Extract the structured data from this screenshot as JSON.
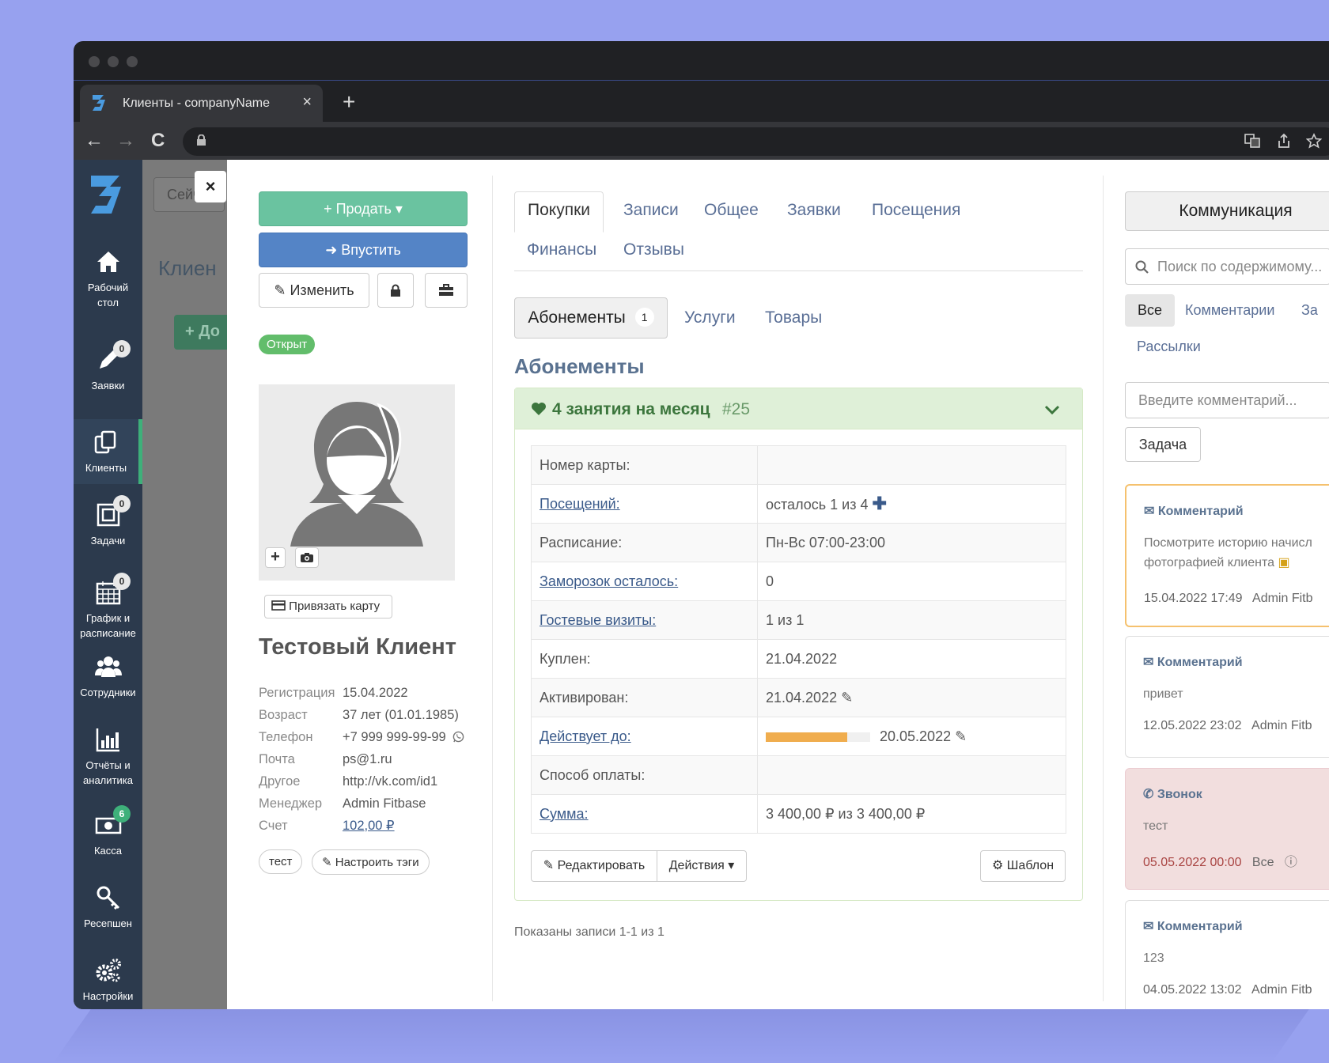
{
  "browser": {
    "tab_title": "Клиенты - companyName",
    "new_tab": "+",
    "tab_close": "×",
    "back": "←",
    "forward": "→",
    "reload": "C"
  },
  "sidebar": {
    "items": [
      {
        "label_line1": "Рабочий",
        "label_line2": "стол",
        "icon": "home-icon"
      },
      {
        "label_line1": "Заявки",
        "label_line2": "",
        "icon": "pencil-icon",
        "badge": "0"
      },
      {
        "label_line1": "Клиенты",
        "label_line2": "",
        "icon": "clients-icon"
      },
      {
        "label_line1": "Задачи",
        "label_line2": "",
        "icon": "tasks-icon",
        "badge": "0"
      },
      {
        "label_line1": "График и",
        "label_line2": "расписание",
        "icon": "calendar-icon",
        "badge": "0"
      },
      {
        "label_line1": "Сотрудники",
        "label_line2": "",
        "icon": "users-icon"
      },
      {
        "label_line1": "Отчёты и",
        "label_line2": "аналитика",
        "icon": "chart-icon"
      },
      {
        "label_line1": "Касса",
        "label_line2": "",
        "icon": "cash-icon",
        "badge": "6"
      },
      {
        "label_line1": "Ресепшен",
        "label_line2": "",
        "icon": "key-icon"
      },
      {
        "label_line1": "Настройки",
        "label_line2": "",
        "icon": "gears-icon"
      }
    ],
    "active_color": "#3eb07a"
  },
  "background": {
    "search_fragment": "Сейчас",
    "title_fragment": "Клиен",
    "add_fragment": "+ До"
  },
  "modal": {
    "close": "×",
    "client": {
      "sell_label": "+ Продать ▾",
      "admit_label": "➜ Впустить",
      "edit_label": "✎ Изменить",
      "status": "Открыт",
      "bind_card_label": "Привязать карту",
      "name": "Тестовый Клиент",
      "info": [
        {
          "key": "Регистрация",
          "value": "15.04.2022"
        },
        {
          "key": "Возраст",
          "value": "37 лет (01.01.1985)"
        },
        {
          "key": "Телефон",
          "value": "+7 999 999-99-99"
        },
        {
          "key": "Почта",
          "value": "ps@1.ru"
        },
        {
          "key": "Другое",
          "value": "http://vk.com/id1"
        },
        {
          "key": "Менеджер",
          "value": "Admin Fitbase"
        },
        {
          "key": "Счет",
          "value": "102,00 ₽"
        }
      ],
      "tags": [
        "тест"
      ],
      "tags_button": "✎ Настроить тэги"
    },
    "tabs": [
      "Покупки",
      "Записи",
      "Общее",
      "Заявки",
      "Посещения",
      "Финансы",
      "Отзывы"
    ],
    "subtabs": {
      "subscriptions": "Абонементы",
      "subscriptions_count": "1",
      "services": "Услуги",
      "goods": "Товары"
    },
    "section_title": "Абонементы",
    "subscription": {
      "name": "4 занятия на месяц",
      "number": "#25",
      "rows": [
        {
          "key": "Номер карты:",
          "value": ""
        },
        {
          "key": "Посещений:",
          "value": "осталось 1 из 4"
        },
        {
          "key": "Расписание:",
          "value": "Пн-Вс 07:00-23:00"
        },
        {
          "key": "Заморозок осталось:",
          "value": "0"
        },
        {
          "key": "Гостевые визиты:",
          "value": "1 из 1"
        },
        {
          "key": "Куплен:",
          "value": "21.04.2022"
        },
        {
          "key": "Активирован:",
          "value": "21.04.2022"
        },
        {
          "key": "Действует до:",
          "value": "20.05.2022"
        },
        {
          "key": "Способ оплаты:",
          "value": ""
        },
        {
          "key": "Сумма:",
          "value": "3 400,00 ₽ из 3 400,00 ₽"
        }
      ],
      "validity_progress": 0.78,
      "progress_color": "#f0ad4e",
      "edit_button": "Редактировать",
      "actions_button": "Действия ▾",
      "template_button": "Шаблон"
    },
    "shown_records": "Показаны записи 1-1 из 1",
    "communication": {
      "button": "Коммуникация",
      "search_placeholder": "Поиск по содержимому...",
      "filters": [
        "Все",
        "Комментарии",
        "За",
        "Рассылки"
      ],
      "comment_placeholder": "Введите комментарий...",
      "task_button": "Задача",
      "cards": [
        {
          "type": "Комментарий",
          "body1": "Посмотрите историю начисл",
          "body2": "фотографией клиента",
          "date": "15.04.2022 17:49",
          "author": "Admin Fitb"
        },
        {
          "type": "Комментарий",
          "body1": "привет",
          "date": "12.05.2022 23:02",
          "author": "Admin Fitb"
        },
        {
          "type": "Звонок",
          "body1": "тест",
          "date": "05.05.2022 00:00",
          "author": "Все"
        },
        {
          "type": "Комментарий",
          "body1": "123",
          "date": "04.05.2022 13:02",
          "author": "Admin Fitb"
        }
      ]
    }
  }
}
